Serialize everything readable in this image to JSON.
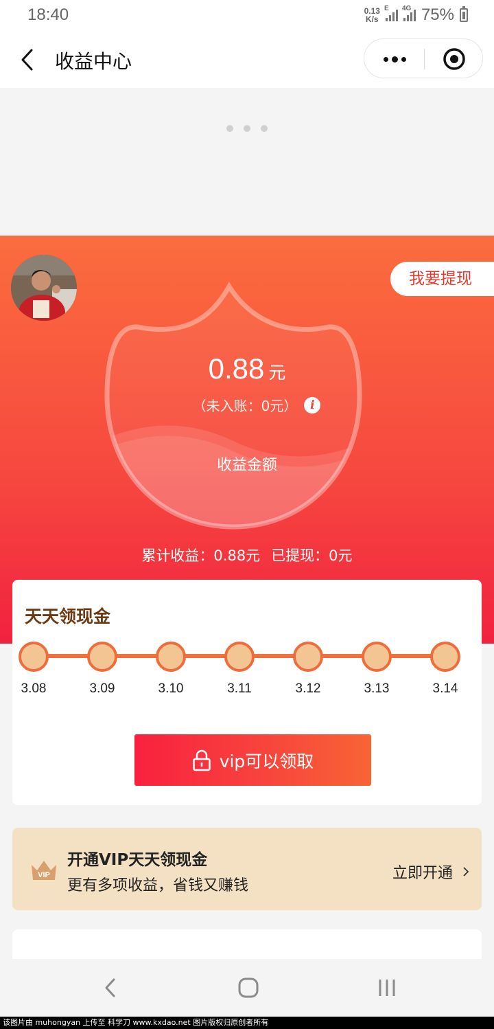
{
  "status_bar": {
    "time": "18:40",
    "net_speed_value": "0.13",
    "net_speed_unit": "K/s",
    "signal1_tag": "E",
    "signal2_tag": "4G",
    "battery": "75%"
  },
  "nav": {
    "title": "收益中心"
  },
  "hero": {
    "withdraw_label": "我要提现",
    "amount": "0.88",
    "amount_unit": "元",
    "pending_text": "（未入账：0元）",
    "info_glyph": "i",
    "earnings_label": "收益金额",
    "total_earnings": "累计收益：0.88元",
    "withdrawn": "已提现：0元"
  },
  "daily": {
    "title": "天天领现金",
    "days": [
      "3.08",
      "3.09",
      "3.10",
      "3.11",
      "3.12",
      "3.13",
      "3.14"
    ],
    "claim_button": "vip可以领取"
  },
  "vip_banner": {
    "badge": "VIP",
    "title": "开通VIP天天领现金",
    "subtitle": "更有多项收益，省钱又赚钱",
    "action": "立即开通"
  },
  "watermark": "该图片由 muhongyan 上传至 科学刀 www.kxdao.net 图片版权归原创者所有",
  "colors": {
    "accent_orange": "#fb6d3e",
    "accent_red": "#f1213f",
    "timeline_dot": "#f3c592",
    "title_brown": "#6b3a12",
    "vip_banner_bg": "#f4e1c4"
  },
  "icons": [
    "back-icon",
    "more-dots-icon",
    "target-icon",
    "info-icon",
    "lock-icon",
    "crown-icon",
    "chevron-right-icon",
    "nav-back-icon",
    "nav-home-icon",
    "nav-recents-icon"
  ]
}
